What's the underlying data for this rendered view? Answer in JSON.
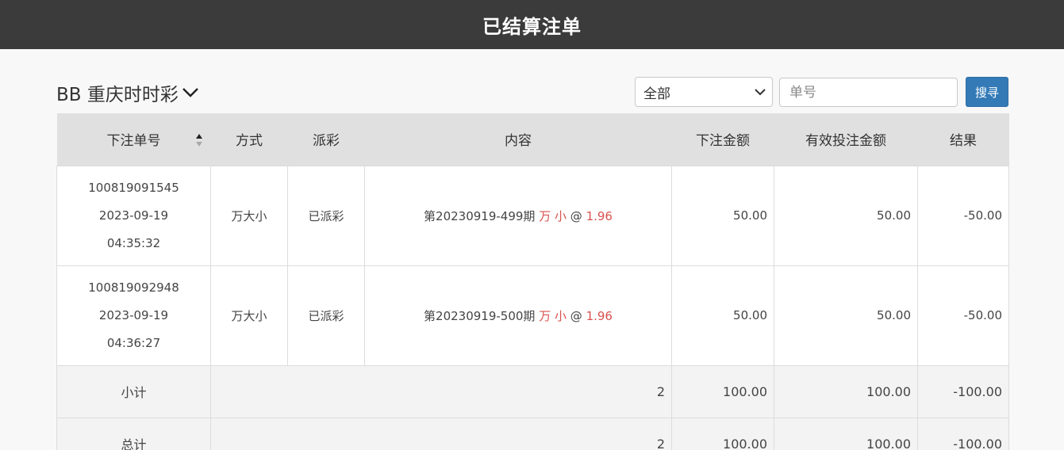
{
  "header": {
    "title": "已结算注单"
  },
  "game": {
    "title": "BB 重庆时时彩"
  },
  "filter": {
    "selected": "全部"
  },
  "search": {
    "placeholder": "单号",
    "button_label": "搜寻"
  },
  "table": {
    "columns": [
      "下注单号",
      "方式",
      "派彩",
      "内容",
      "下注金额",
      "有效投注金额",
      "结果"
    ],
    "rows": [
      {
        "order_no": "100819091545",
        "date": "2023-09-19",
        "time": "04:35:32",
        "method": "万大小",
        "payout": "已派彩",
        "content_prefix": "第20230919-499期",
        "content_pick": "万 小",
        "content_at": "@",
        "content_odds": "1.96",
        "amount": "50.00",
        "valid_amount": "50.00",
        "result": "-50.00"
      },
      {
        "order_no": "100819092948",
        "date": "2023-09-19",
        "time": "04:36:27",
        "method": "万大小",
        "payout": "已派彩",
        "content_prefix": "第20230919-500期",
        "content_pick": "万 小",
        "content_at": "@",
        "content_odds": "1.96",
        "amount": "50.00",
        "valid_amount": "50.00",
        "result": "-50.00"
      }
    ],
    "subtotal": {
      "label": "小计",
      "count": "2",
      "amount": "100.00",
      "valid_amount": "100.00",
      "result": "-100.00"
    },
    "total": {
      "label": "总计",
      "count": "2",
      "amount": "100.00",
      "valid_amount": "100.00",
      "result": "-100.00"
    }
  },
  "colors": {
    "topbar": "#3b3b3b",
    "accent": "#337ab7",
    "negative": "#d9534f"
  }
}
